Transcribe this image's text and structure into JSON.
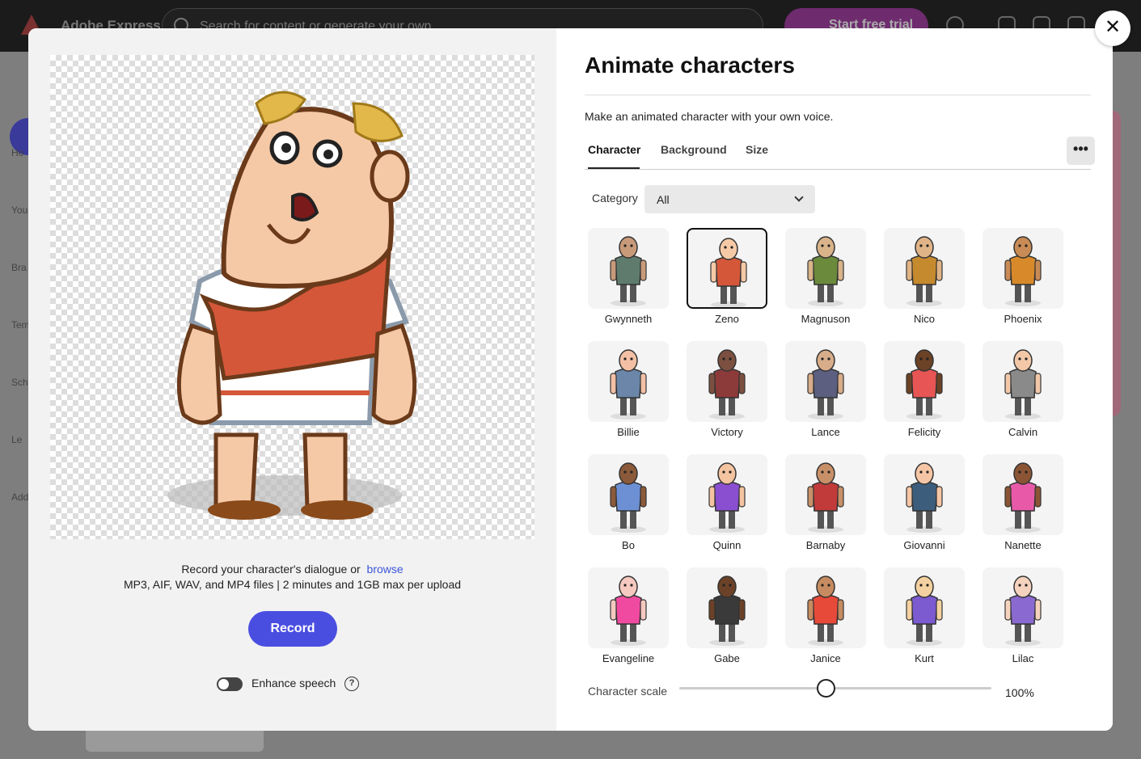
{
  "background_app": {
    "brand": "Adobe Express",
    "search_placeholder": "Search for content or generate your own",
    "trial_label": "Start free trial",
    "sidebar": [
      "Ho",
      "You",
      "Bra",
      "Tem",
      "Sch",
      "Le",
      "Add"
    ]
  },
  "modal": {
    "title": "Animate characters",
    "subtitle": "Make an animated character with your own voice.",
    "tabs": [
      {
        "label": "Character",
        "active": true
      },
      {
        "label": "Background",
        "active": false
      },
      {
        "label": "Size",
        "active": false
      }
    ],
    "more_label": "•••",
    "category_label": "Category",
    "category_value": "All",
    "characters": [
      {
        "name": "Gwynneth",
        "color": "#5f7b6e",
        "skin": "#c89a7a"
      },
      {
        "name": "Zeno",
        "color": "#d4573a",
        "skin": "#f6c9a6",
        "selected": true
      },
      {
        "name": "Magnuson",
        "color": "#6b8a3c",
        "skin": "#d9b48a"
      },
      {
        "name": "Nico",
        "color": "#c68a2e",
        "skin": "#e0b487"
      },
      {
        "name": "Phoenix",
        "color": "#d88a2a",
        "skin": "#c88b55"
      },
      {
        "name": "Billie",
        "color": "#6b86a8",
        "skin": "#f3c0a6"
      },
      {
        "name": "Victory",
        "color": "#8d3a3a",
        "skin": "#7c5040"
      },
      {
        "name": "Lance",
        "color": "#5d5f80",
        "skin": "#d8ad8a"
      },
      {
        "name": "Felicity",
        "color": "#e85555",
        "skin": "#6b4226"
      },
      {
        "name": "Calvin",
        "color": "#8a8a8a",
        "skin": "#f2c8a8"
      },
      {
        "name": "Bo",
        "color": "#6d8fd3",
        "skin": "#8b5a3a"
      },
      {
        "name": "Quinn",
        "color": "#8a4ed0",
        "skin": "#f4c3a0"
      },
      {
        "name": "Barnaby",
        "color": "#c23b3b",
        "skin": "#c89068"
      },
      {
        "name": "Giovanni",
        "color": "#3d5d7d",
        "skin": "#f5c6a6"
      },
      {
        "name": "Nanette",
        "color": "#e85aa8",
        "skin": "#8b5535"
      },
      {
        "name": "Evangeline",
        "color": "#f04aa0",
        "skin": "#f5c8c0"
      },
      {
        "name": "Gabe",
        "color": "#3a3a3a",
        "skin": "#6b4228"
      },
      {
        "name": "Janice",
        "color": "#e84a3a",
        "skin": "#c68b60"
      },
      {
        "name": "Kurt",
        "color": "#7c5ad0",
        "skin": "#f4d1a0"
      },
      {
        "name": "Lilac",
        "color": "#8a6ad0",
        "skin": "#f5d2bd"
      }
    ],
    "scale_label": "Character scale",
    "scale_value_text": "100%",
    "scale_fraction": 0.47,
    "record_hint": "Record your character's dialogue or",
    "browse_label": "browse",
    "file_hint": "MP3, AIF, WAV, and MP4 files | 2 minutes and 1GB max per upload",
    "record_label": "Record",
    "enhance_label": "Enhance speech",
    "enhance_on": false,
    "help_label": "?",
    "close_label": "✕"
  }
}
